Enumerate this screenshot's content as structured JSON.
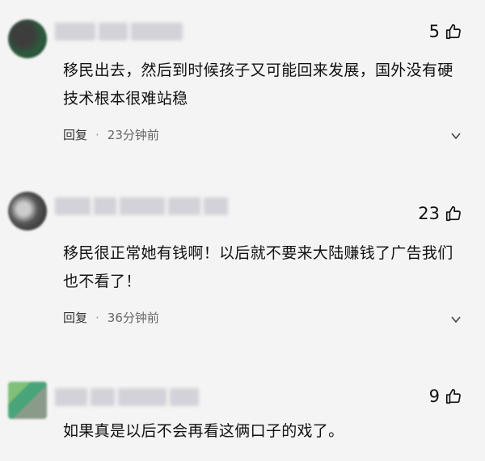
{
  "comments": [
    {
      "likes": "5",
      "text": "移民出去，然后到时候孩子又可能回来发展，国外没有硬技术根本很难站稳",
      "reply": "回复",
      "dot": "·",
      "time": "23分钟前"
    },
    {
      "likes": "23",
      "text": "移民很正常她有钱啊！以后就不要来大陆赚钱了广告我们也不看了！",
      "reply": "回复",
      "dot": "·",
      "time": "36分钟前"
    },
    {
      "likes": "9",
      "text": "如果真是以后不会再看这俩口子的戏了。"
    }
  ],
  "icons": {
    "like": "thumbs-up-icon",
    "more": "more-icon"
  }
}
